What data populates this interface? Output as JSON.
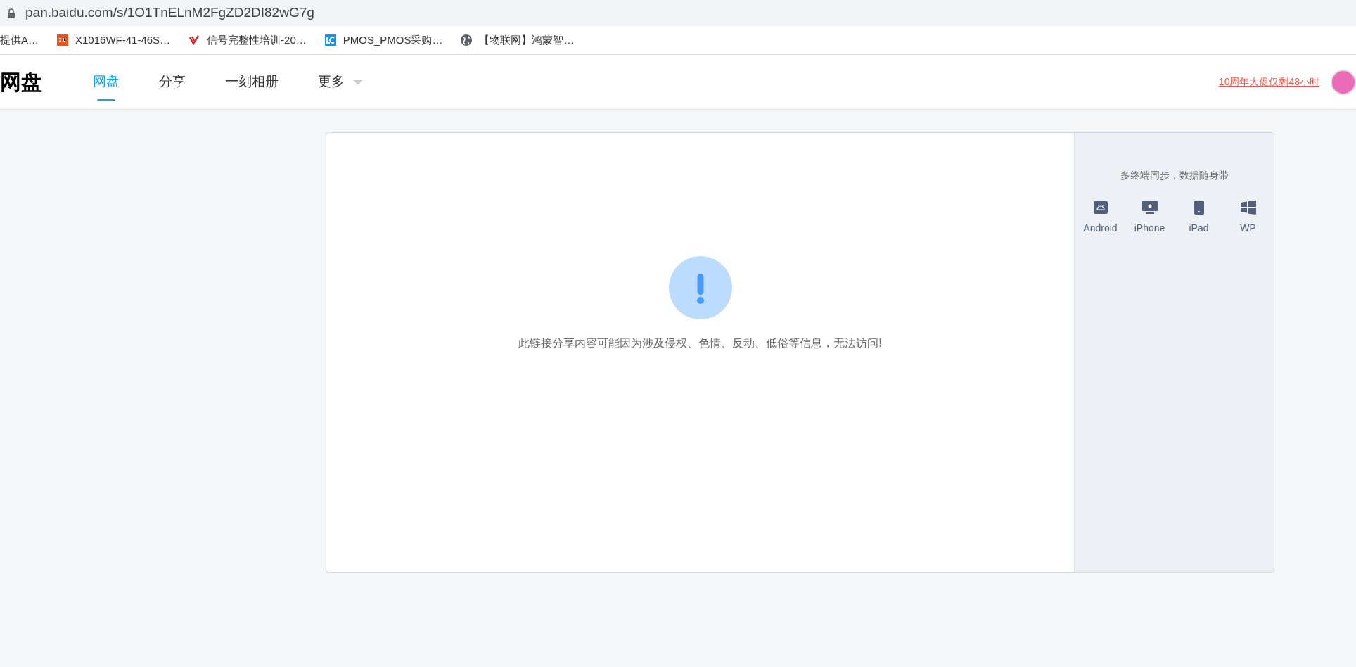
{
  "address_bar": {
    "url": "pan.baidu.com/s/1O1TnELnM2FgZD2DI82wG7g"
  },
  "bookmarks": [
    {
      "kind": "none",
      "label": "提供A…"
    },
    {
      "kind": "xkb",
      "label": "X1016WF-41-46S…"
    },
    {
      "kind": "red",
      "label": "信号完整性培训-20…"
    },
    {
      "kind": "lc",
      "label": "PMOS_PMOS采购…"
    },
    {
      "kind": "globe",
      "label": "【物联网】鸿蒙智…"
    }
  ],
  "header": {
    "logo": "网盘",
    "nav": [
      {
        "label": "网盘",
        "selected": true,
        "dropdown": false
      },
      {
        "label": "分享",
        "selected": false,
        "dropdown": false
      },
      {
        "label": "一刻相册",
        "selected": false,
        "dropdown": false
      },
      {
        "label": "更多",
        "selected": false,
        "dropdown": true
      }
    ],
    "promo": "10周年大促仅剩48小时"
  },
  "message": "此链接分享内容可能因为涉及侵权、色情、反动、低俗等信息，无法访问!",
  "side_panel": {
    "title": "多终端同步，数据随身带",
    "platforms": [
      {
        "kind": "android",
        "label": "Android"
      },
      {
        "kind": "iphone",
        "label": "iPhone"
      },
      {
        "kind": "ipad",
        "label": "iPad"
      },
      {
        "kind": "wp",
        "label": "WP"
      }
    ]
  }
}
